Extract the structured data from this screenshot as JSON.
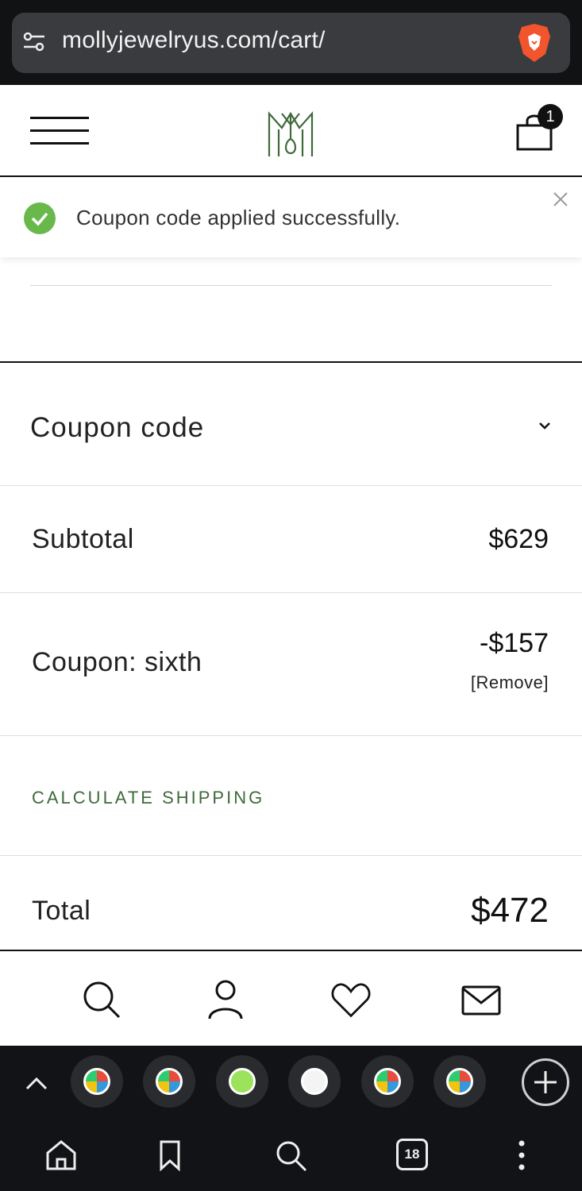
{
  "browser": {
    "url": "mollyjewelryus.com/cart/",
    "open_tabs_count": "18"
  },
  "header": {
    "cart_count": "1"
  },
  "notice": {
    "message": "Coupon code applied successfully."
  },
  "cart_totals": {
    "coupon_code_label": "Coupon code",
    "subtotal_label": "Subtotal",
    "subtotal_value": "$629",
    "coupon_label": "Coupon: sixth",
    "coupon_discount": "-$157",
    "remove_label": "[Remove]",
    "calculate_shipping": "CALCULATE SHIPPING",
    "total_label": "Total",
    "total_value": "$472"
  },
  "colors": {
    "brand_green": "#3f6a3a",
    "success_green": "#69b84c"
  }
}
